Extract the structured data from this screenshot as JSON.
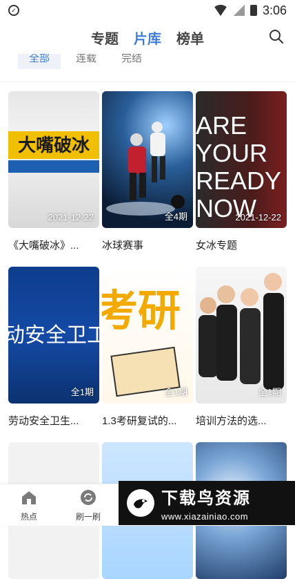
{
  "status_bar": {
    "time": "3:06"
  },
  "top_nav": {
    "tabs": [
      {
        "label": "专题"
      },
      {
        "label": "片库"
      },
      {
        "label": "榜单"
      }
    ],
    "active_tab": "片库",
    "accent_color": "#3f7ed6"
  },
  "filter": {
    "items": [
      {
        "label": "全部"
      },
      {
        "label": "连载"
      },
      {
        "label": "完结"
      }
    ],
    "active": "全部"
  },
  "cards": [
    {
      "title": "《大嘴破冰》...",
      "badge": "2021-12-22",
      "thumb_text": "大嘴破冰"
    },
    {
      "title": "冰球赛事",
      "badge": "全4期",
      "thumb_text": ""
    },
    {
      "title": "女冰专题",
      "badge": "2021-12-22",
      "thumb_text": "ARE YOUR READY NOW"
    },
    {
      "title": "劳动安全卫生...",
      "badge": "全1期",
      "thumb_text": "动安全卫工"
    },
    {
      "title": "1.3考研复试的...",
      "badge": "全1期",
      "thumb_text": "考研"
    },
    {
      "title": "培训方法的选...",
      "badge": "全1期",
      "thumb_text": ""
    },
    {
      "title": "",
      "badge": "",
      "thumb_text": ""
    },
    {
      "title": "",
      "badge": "",
      "thumb_text": ""
    },
    {
      "title": "",
      "badge": "",
      "thumb_text": ""
    }
  ],
  "bottom_nav": {
    "items": [
      {
        "label": "热点",
        "icon": "home-icon"
      },
      {
        "label": "刷一刷",
        "icon": "refresh-icon"
      }
    ]
  },
  "watermark": {
    "title": "下载鸟资源",
    "url": "www.xiazainiao.com"
  }
}
